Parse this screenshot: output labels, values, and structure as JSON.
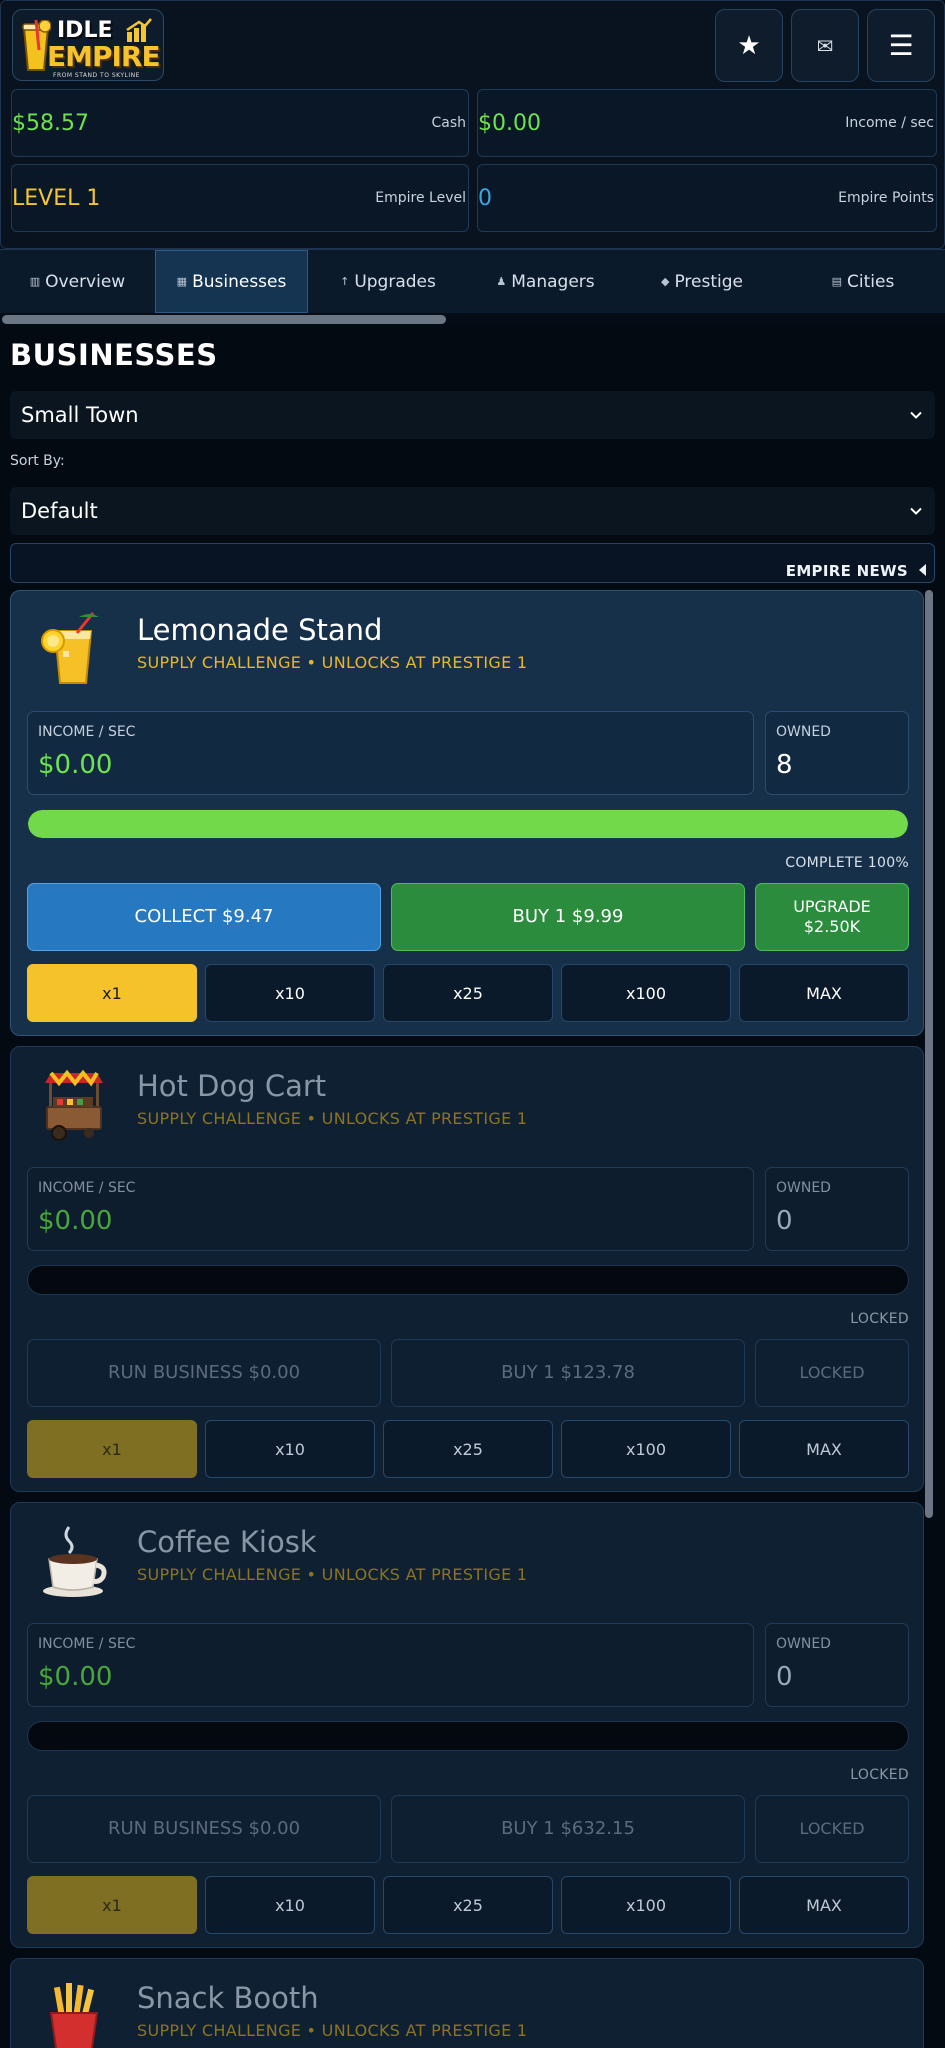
{
  "app": {
    "logo_line1": "IDLE",
    "logo_line2": "EMPIRE",
    "logo_tagline": "FROM STAND TO SKYLINE"
  },
  "header": {
    "buttons": [
      {
        "name": "favorites",
        "icon": "star-icon",
        "glyph": "★"
      },
      {
        "name": "mail",
        "icon": "mail-icon",
        "glyph": "✉"
      },
      {
        "name": "menu",
        "icon": "hamburger-menu-icon",
        "glyph": "☰"
      }
    ],
    "stats": {
      "cash": {
        "value": "$58.57",
        "label": "Cash"
      },
      "income": {
        "value": "$0.00",
        "label": "Income / sec"
      },
      "level": {
        "value": "LEVEL 1",
        "label": "Empire Level"
      },
      "points": {
        "value": "0",
        "label": "Empire Points"
      }
    }
  },
  "tabs": [
    {
      "label": "Overview",
      "icon": "overview-icon",
      "glyph": "▥"
    },
    {
      "label": "Businesses",
      "icon": "businesses-icon",
      "glyph": "▦"
    },
    {
      "label": "Upgrades",
      "icon": "upgrade-arrow-icon",
      "glyph": "↑"
    },
    {
      "label": "Managers",
      "icon": "manager-person-icon",
      "glyph": "♟"
    },
    {
      "label": "Prestige",
      "icon": "diamond-icon",
      "glyph": "◆"
    },
    {
      "label": "Cities",
      "icon": "city-icon",
      "glyph": "▤"
    }
  ],
  "active_tab": "Businesses",
  "section": {
    "title": "BUSINESSES",
    "city_select": "Small Town",
    "sort_label": "Sort By:",
    "sort_select": "Default",
    "news_label": "EMPIRE NEWS"
  },
  "business_labels": {
    "income": "INCOME / SEC",
    "owned": "OWNED"
  },
  "multipliers": [
    "x1",
    "x10",
    "x25",
    "x100",
    "MAX"
  ],
  "businesses": [
    {
      "name": "Lemonade Stand",
      "icon": "lemonade-glass-icon",
      "subtitle": "SUPPLY CHALLENGE • UNLOCKS AT PRESTIGE 1",
      "income": "$0.00",
      "owned": "8",
      "progress": 1.0,
      "status": "COMPLETE 100%",
      "action1": "COLLECT  $9.47",
      "action2": "BUY 1  $9.99",
      "action3_line1": "UPGRADE",
      "action3_line2": "$2.50K",
      "selected_multiplier": "x1"
    },
    {
      "name": "Hot Dog Cart",
      "icon": "hot-dog-cart-icon",
      "subtitle": "SUPPLY CHALLENGE • UNLOCKS AT PRESTIGE 1",
      "income": "$0.00",
      "owned": "0",
      "progress": 0.0,
      "status": "LOCKED",
      "action1": "RUN BUSINESS  $0.00",
      "action2": "BUY 1  $123.78",
      "action3_line1": "LOCKED",
      "action3_line2": "",
      "selected_multiplier": "x1"
    },
    {
      "name": "Coffee Kiosk",
      "icon": "coffee-cup-icon",
      "subtitle": "SUPPLY CHALLENGE • UNLOCKS AT PRESTIGE 1",
      "income": "$0.00",
      "owned": "0",
      "progress": 0.0,
      "status": "LOCKED",
      "action1": "RUN BUSINESS  $0.00",
      "action2": "BUY 1  $632.15",
      "action3_line1": "LOCKED",
      "action3_line2": "",
      "selected_multiplier": "x1"
    },
    {
      "name": "Snack Booth",
      "icon": "french-fries-icon",
      "subtitle": "SUPPLY CHALLENGE • UNLOCKS AT PRESTIGE 1"
    }
  ],
  "colors": {
    "background": "#040a12",
    "cash_green": "#6ee24f",
    "level_gold": "#f5c62f",
    "points_blue": "#3aa7e0",
    "collect_blue": "#2679c0",
    "buy_green": "#2a8c3c",
    "progress_green": "#71d94a",
    "selected_gold": "#f5c22c"
  }
}
